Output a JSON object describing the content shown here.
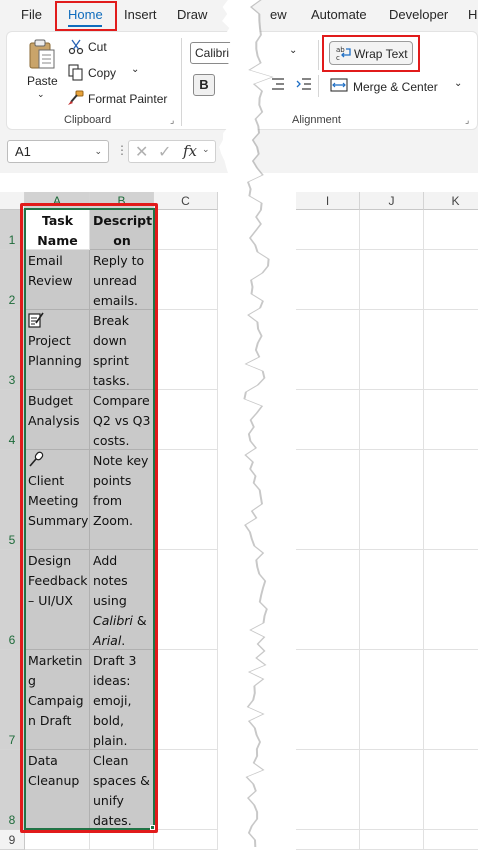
{
  "menu": {
    "file": "File",
    "home": "Home",
    "insert": "Insert",
    "draw": "Draw",
    "page_frag": "P",
    "view_frag": "ew",
    "automate": "Automate",
    "developer": "Developer",
    "help_frag": "H"
  },
  "clipboard": {
    "paste": "Paste",
    "cut": "Cut",
    "copy": "Copy",
    "format_painter": "Format Painter",
    "group_label": "Clipboard"
  },
  "font": {
    "font_name": "Calibri",
    "bold": "B"
  },
  "alignment": {
    "wrap_text": "Wrap Text",
    "merge_center": "Merge & Center",
    "group_label": "Alignment"
  },
  "formula_bar": {
    "name_box": "A1",
    "fx": "fx"
  },
  "columns": [
    "A",
    "B",
    "C",
    "I",
    "J",
    "K"
  ],
  "rows": [
    "1",
    "2",
    "3",
    "4",
    "5",
    "6",
    "7",
    "8",
    "9"
  ],
  "sheet": {
    "header_a": [
      "Task",
      "Name"
    ],
    "header_b": [
      "Descripti",
      "on"
    ],
    "tasks": [
      {
        "a": [
          "Email",
          "Review"
        ],
        "b": [
          "Reply to",
          "unread",
          "emails."
        ]
      },
      {
        "icon": "memo-icon",
        "a": [
          "Project",
          "Planning"
        ],
        "b": [
          "Break",
          "down",
          "sprint",
          "tasks."
        ]
      },
      {
        "a": [
          "Budget",
          "Analysis"
        ],
        "b": [
          "Compare",
          "Q2 vs Q3",
          "costs."
        ]
      },
      {
        "icon": "microphone-icon",
        "a": [
          "Client",
          "Meeting",
          "Summary"
        ],
        "b": [
          "Note key",
          "points",
          "from",
          "Zoom."
        ]
      },
      {
        "a": [
          "Design",
          "Feedback",
          "– UI/UX"
        ],
        "b_pre": [
          "Add",
          "notes",
          "using"
        ],
        "b_italic_1": "Calibri",
        "b_amp": " &",
        "b_italic_2": "Arial",
        "b_end": "."
      },
      {
        "a": [
          "Marketin",
          "g",
          "Campaig",
          "n Draft"
        ],
        "b": [
          "Draft 3",
          "ideas:",
          "emoji,",
          "bold,",
          "plain."
        ]
      },
      {
        "a": [
          "Data",
          "Cleanup"
        ],
        "b": [
          "Clean",
          "spaces &",
          "unify",
          "dates."
        ]
      }
    ]
  }
}
